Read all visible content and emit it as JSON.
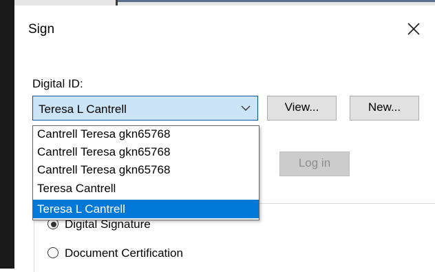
{
  "dialog": {
    "title": "Sign"
  },
  "digital_id": {
    "label": "Digital ID:",
    "selected_value": "Teresa L Cantrell",
    "options": [
      "Cantrell Teresa gkn65768",
      "Cantrell Teresa gkn65768",
      "Cantrell Teresa gkn65768",
      "Teresa Cantrell",
      "Teresa L Cantrell"
    ],
    "highlighted_index": 4
  },
  "buttons": {
    "view": "View...",
    "new": "New...",
    "login": "Log in"
  },
  "sign_as": {
    "options": [
      {
        "label": "Digital Signature",
        "checked": true
      },
      {
        "label": "Document Certification",
        "checked": false
      }
    ]
  },
  "colors": {
    "accent": "#0078d7",
    "combo_background": "#cce4f7",
    "combo_border": "#005499",
    "button_background": "#e1e1e1",
    "disabled_text": "#8d8d8d"
  },
  "icons": {
    "close": "close-icon",
    "dropdown": "chevron-down-icon",
    "radio_selected": "radio-selected-icon",
    "radio_empty": "radio-empty-icon"
  }
}
